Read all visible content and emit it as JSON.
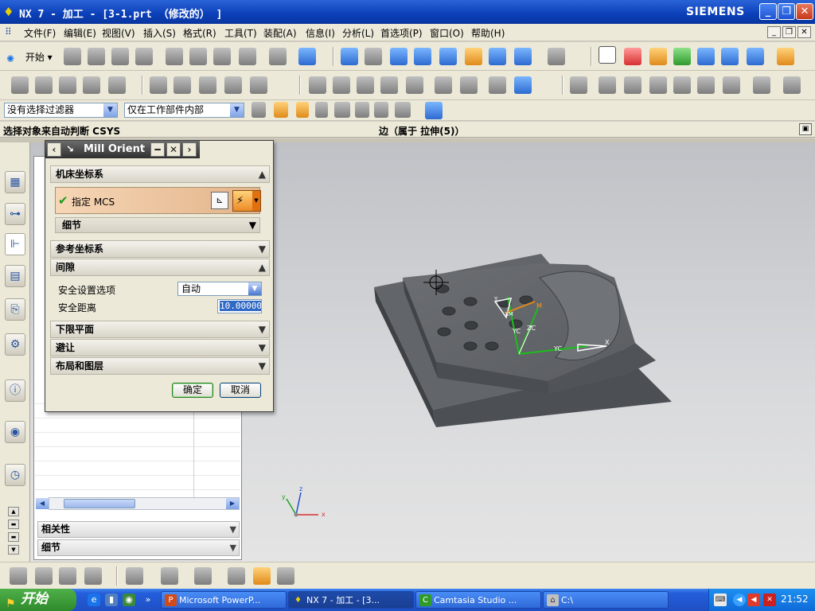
{
  "window": {
    "title": "NX 7 - 加工 - [3-1.prt （修改的） ]",
    "brand": "SIEMENS",
    "minimize": "_",
    "restore": "❐",
    "close": "✕"
  },
  "menubar": {
    "items": [
      "文件(F)",
      "编辑(E)",
      "视图(V)",
      "插入(S)",
      "格式(R)",
      "工具(T)",
      "装配(A)",
      "信息(I)",
      "分析(L)",
      "首选项(P)",
      "窗口(O)",
      "帮助(H)"
    ]
  },
  "toolbar": {
    "start_label": "开始"
  },
  "selection_bar": {
    "type_filter": "没有选择过滤器",
    "scope_filter": "仅在工作部件内部"
  },
  "cue_line": {
    "cue": "选择对象来自动判断 CSYS",
    "status": "边（属于 拉伸(5)）"
  },
  "navigator": {
    "sections": [
      "相关性",
      "细节"
    ]
  },
  "dialog": {
    "title": "Mill Orient",
    "groups": {
      "mcs": "机床坐标系",
      "specify_mcs": "指定 MCS",
      "details": "细节",
      "ref_csys": "参考坐标系",
      "clearance": "间隙",
      "safety_option_label": "安全设置选项",
      "safety_option_value": "自动",
      "safety_distance_label": "安全距离",
      "safety_distance_value": "10.00000",
      "lower_plane": "下限平面",
      "avoidance": "避让",
      "layout_layers": "布局和图层"
    },
    "ok": "确定",
    "cancel": "取消"
  },
  "model_labels": {
    "y": "Y",
    "xm": "XM",
    "m": "M",
    "yc": "YC",
    "zc": "ZC",
    "yc2": "YC",
    "x": "X"
  },
  "triad": {
    "x": "x",
    "y": "y",
    "z": "z"
  },
  "taskbar": {
    "start": "开始",
    "tasks": [
      "Microsoft PowerP...",
      "NX 7 - 加工 - [3...",
      "Camtasia Studio ...",
      "C:\\"
    ],
    "clock": "21:52"
  }
}
